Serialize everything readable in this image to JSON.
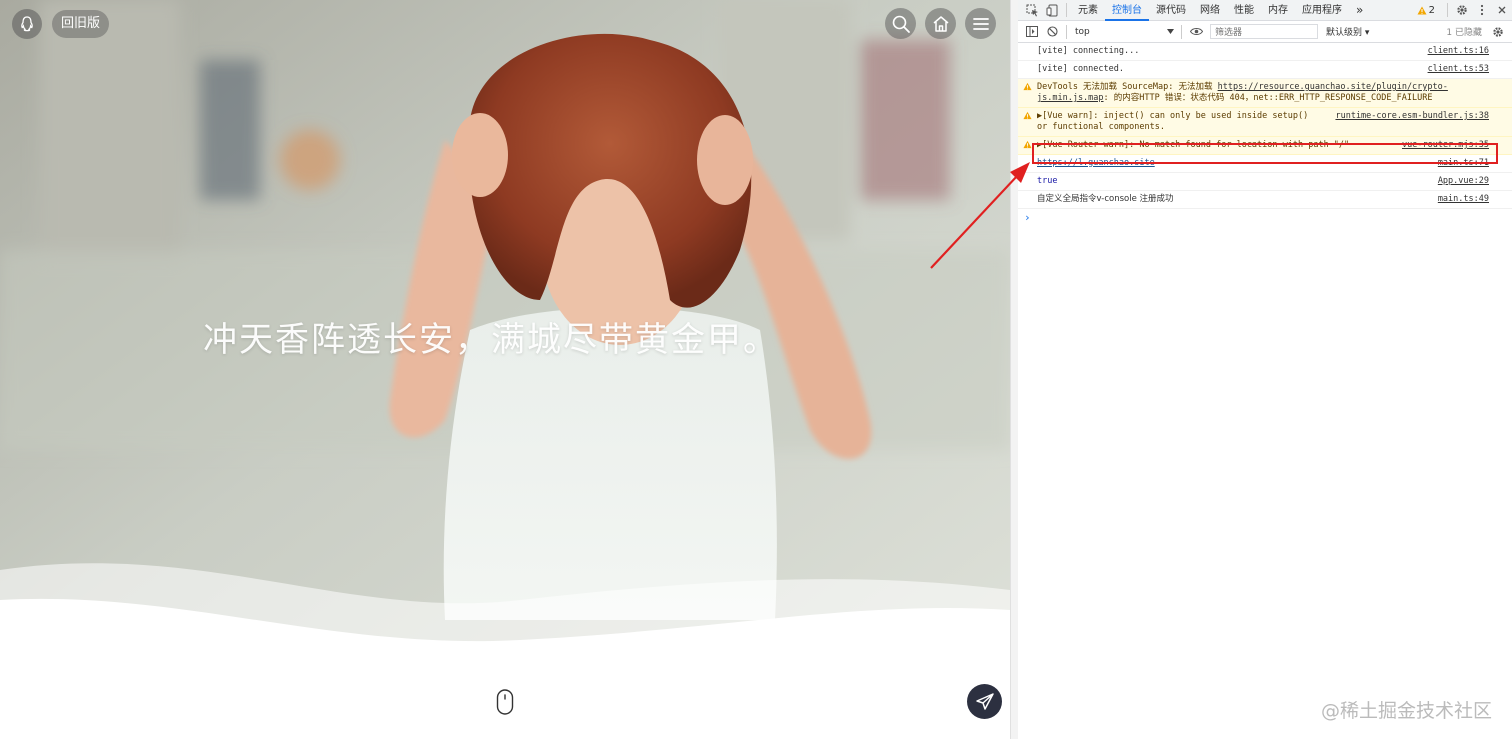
{
  "site": {
    "old_version_label": "回旧版",
    "slogan": "冲天香阵透长安，满城尽带黄金甲。"
  },
  "devtools": {
    "tabs": [
      {
        "label": "元素"
      },
      {
        "label": "控制台"
      },
      {
        "label": "源代码"
      },
      {
        "label": "网络"
      },
      {
        "label": "性能"
      },
      {
        "label": "内存"
      },
      {
        "label": "应用程序"
      }
    ],
    "more_tabs": "»",
    "warning_count": "2",
    "context": "top",
    "filter_placeholder": "筛选器",
    "levels_label": "默认级别 ▾",
    "hidden_label": "1 已隐藏",
    "console_rows": [
      {
        "text": "[vite] connecting...",
        "source": "client.ts:16"
      },
      {
        "text": "[vite] connected.",
        "source": "client.ts:53"
      },
      {
        "text_prefix": "DevTools 无法加载 SourceMap: 无法加载 ",
        "link": "https://resource.guanchao.site/plugin/crypto-js.min.js.map",
        "text_suffix": ": 的内容HTTP 错误：状态代码 404，net::ERR_HTTP_RESPONSE_CODE_FAILURE"
      },
      {
        "text": "▶[Vue warn]: inject() can only be used inside setup() or functional components.",
        "source": "runtime-core.esm-bundler.js:38"
      },
      {
        "text": "▶[Vue Router warn]: No match found for location with path \"/\"",
        "source": "vue-router.mjs:35"
      },
      {
        "link": "https://l.guanchao.site",
        "source": "main.ts:71"
      },
      {
        "text": "true",
        "source": "App.vue:29"
      },
      {
        "text": "自定义全局指令v-console 注册成功",
        "source": "main.ts:49"
      }
    ],
    "prompt": "›"
  },
  "watermark": "@稀土掘金技术社区",
  "colors": {
    "highlight_box": "#e02020",
    "arrow": "#e02020",
    "accent": "#1a73e8"
  }
}
